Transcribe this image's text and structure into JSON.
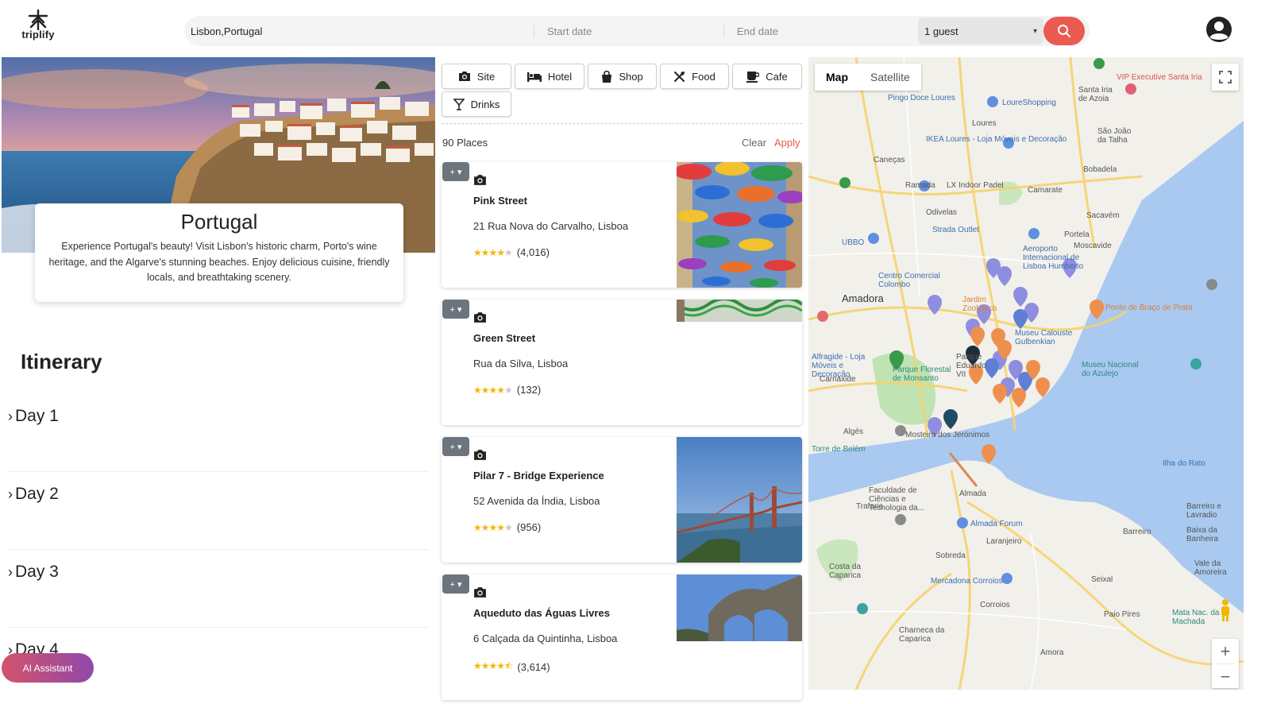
{
  "app": {
    "name": "triplify"
  },
  "search": {
    "destination": "Lisbon,Portugal",
    "start_placeholder": "Start date",
    "end_placeholder": "End date",
    "guests": "1 guest"
  },
  "destination": {
    "country": "Portugal",
    "description": "Experience Portugal's beauty! Visit Lisbon's historic charm, Porto's wine heritage, and the Algarve's stunning beaches. Enjoy delicious cuisine, friendly locals, and breathtaking scenery."
  },
  "itinerary": {
    "title": "Itinerary",
    "days": [
      "Day 1",
      "Day 2",
      "Day 3",
      "Day 4"
    ]
  },
  "ai_assistant": "AI Assistant",
  "filters": [
    {
      "label": "Site",
      "icon": "camera-icon"
    },
    {
      "label": "Hotel",
      "icon": "bed-icon"
    },
    {
      "label": "Shop",
      "icon": "shopping-bag-icon"
    },
    {
      "label": "Food",
      "icon": "utensils-icon"
    },
    {
      "label": "Cafe",
      "icon": "coffee-icon"
    },
    {
      "label": "Drinks",
      "icon": "cocktail-icon"
    }
  ],
  "results": {
    "count": "90 Places",
    "clear": "Clear",
    "apply": "Apply"
  },
  "places": [
    {
      "add": "+ ▾",
      "name": "Pink Street",
      "address": "21 Rua Nova do Carvalho, Lisboa",
      "rating": 4,
      "reviews": "(4,016)"
    },
    {
      "add": "+ ▾",
      "name": "Green Street",
      "address": "Rua da Silva, Lisboa",
      "rating": 4,
      "reviews": "(132)"
    },
    {
      "add": "+ ▾",
      "name": "Pilar 7 - Bridge Experience",
      "address": "52 Avenida da Índia, Lisboa",
      "rating": 4,
      "reviews": "(956)"
    },
    {
      "add": "+ ▾",
      "name": "Aqueduto das Águas Livres",
      "address": "6 Calçada da Quintinha, Lisboa",
      "rating": 4.5,
      "reviews": "(3,614)"
    }
  ],
  "map": {
    "type_map": "Map",
    "type_satellite": "Satellite",
    "labels": [
      "Pingo Doce Loures",
      "LoureShopping",
      "Loures",
      "IKEA Loures - Loja Móveis e Decoração",
      "Caneças",
      "Ramada",
      "LX Indoor Padel",
      "Camarate",
      "Odivelas",
      "Strada Outlet",
      "Sacavém",
      "Portela",
      "Moscavide",
      "Amadora",
      "UBBO",
      "Centro Comercial Colombo",
      "Aeroporto Internacional de Lisboa Humberto",
      "Carnaxide",
      "Parque Florestal de Monsanto",
      "Algés",
      "Torre de Belém",
      "Mosteiro dos Jerónimos",
      "Museu Nacional do Azulejo",
      "Almada",
      "Trafaria",
      "Laranjeiro",
      "Sobreda",
      "Costa da Caparica",
      "Mercadona Corroios",
      "Corroios",
      "Seixal",
      "Barreiro",
      "Paio Pires",
      "Amora",
      "Charneca da Caparica",
      "Santa Iria de Azoia",
      "São João da Talha",
      "Bobadela",
      "VIP Executive Santa Iria",
      "Almada Forum",
      "Baixa da Banheira",
      "Vale da Amoreira",
      "Barreiro e Lavradio",
      "Ilha do Rato",
      "Faculdade de Ciências e Tecnologia da...",
      "Mata Nac. da Machada",
      "Caneças",
      "Alfragide - Loja Móveis e Decoração",
      "Jardim Zoológico",
      "Museu Calouste Gulbenkian",
      "Parque Eduardo VII",
      "Ponte de Braço de Prata"
    ]
  },
  "colors": {
    "accent_red": "#ea5a50",
    "ai_gradient_start": "#d5536b",
    "ai_gradient_end": "#8f49a9",
    "star": "#f5b700",
    "add_button": "#6c757d",
    "map_water": "#a9c9f1",
    "map_land": "#f2f0ea",
    "map_park": "#bfe3b3",
    "pin_purple": "#8e8ee0",
    "pin_orange": "#ef8f4e"
  }
}
